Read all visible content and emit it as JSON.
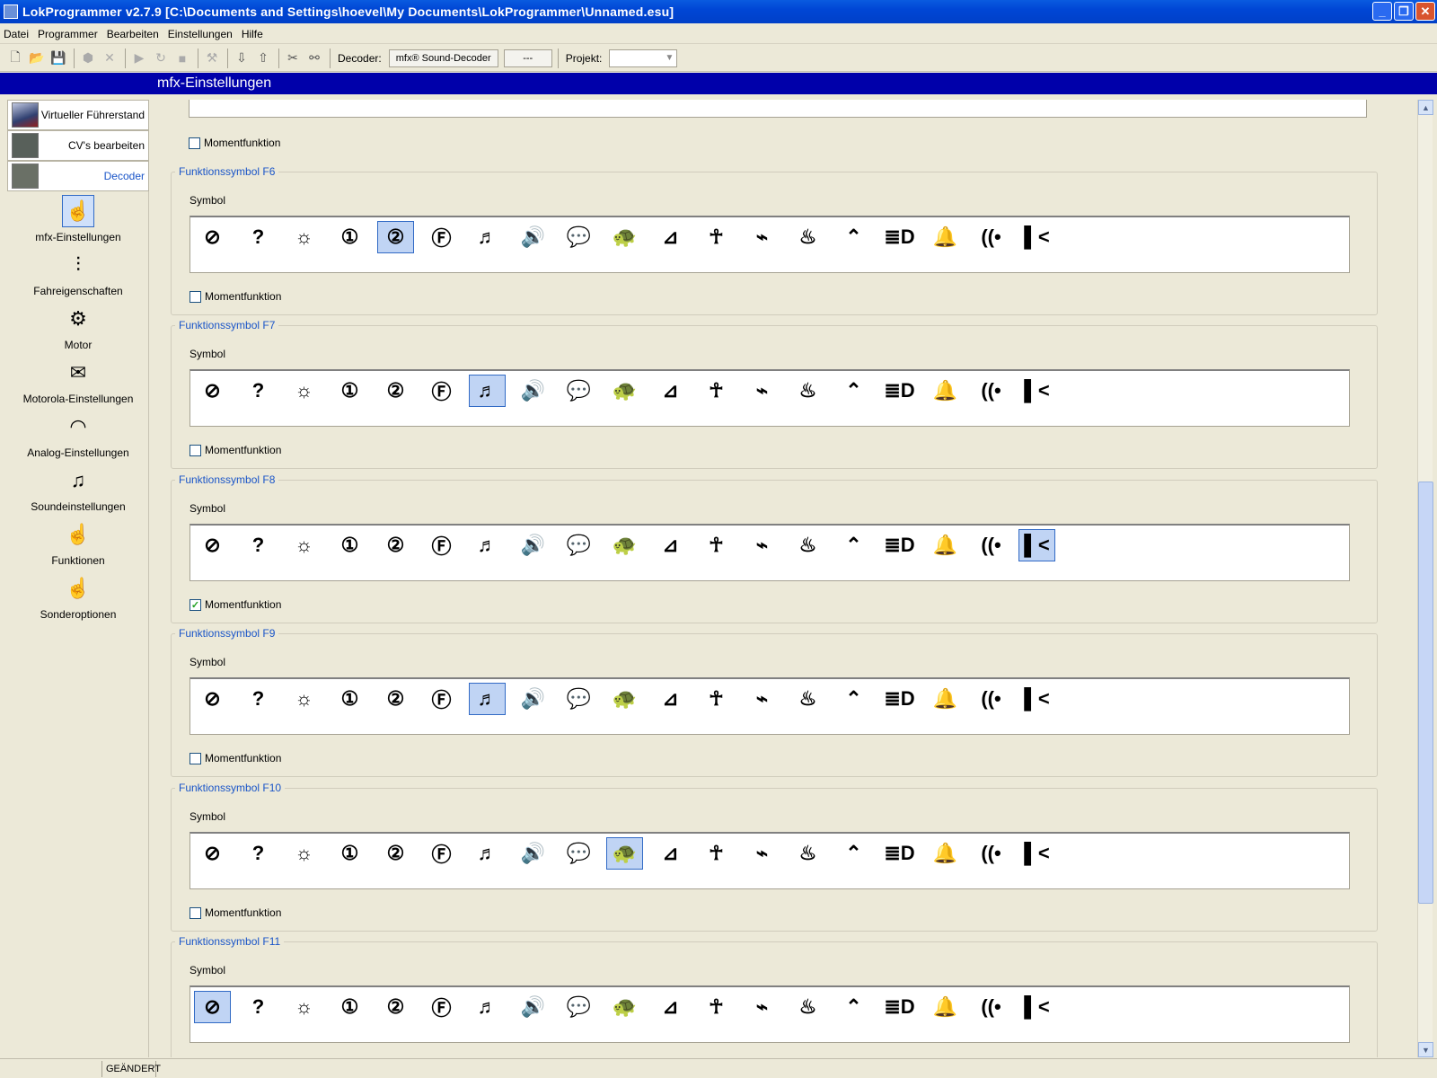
{
  "window": {
    "title": "LokProgrammer  v2.7.9  [C:\\Documents and Settings\\hoevel\\My Documents\\LokProgrammer\\Unnamed.esu]"
  },
  "menu": [
    "Datei",
    "Programmer",
    "Bearbeiten",
    "Einstellungen",
    "Hilfe"
  ],
  "toolbar": {
    "decoder_label": "Decoder:",
    "decoder_value": "mfx® Sound-Decoder",
    "decoder_extra": "---",
    "projekt_label": "Projekt:"
  },
  "header": {
    "title": "mfx-Einstellungen"
  },
  "sidebar": {
    "top": [
      {
        "label": "Virtueller Führerstand"
      },
      {
        "label": "CV's bearbeiten"
      },
      {
        "label": "Decoder"
      }
    ],
    "items": [
      {
        "label": "mfx-Einstellungen",
        "icon": "hand-switch-icon"
      },
      {
        "label": "Fahreigenschaften",
        "icon": "sliders-icon"
      },
      {
        "label": "Motor",
        "icon": "motor-icon"
      },
      {
        "label": "Motorola-Einstellungen",
        "icon": "envelope-icon"
      },
      {
        "label": "Analog-Einstellungen",
        "icon": "dcc-gauge-icon"
      },
      {
        "label": "Soundeinstellungen",
        "icon": "music-sliders-icon"
      },
      {
        "label": "Funktionen",
        "icon": "hand-switch-icon"
      },
      {
        "label": "Sonderoptionen",
        "icon": "hand-switch-icon"
      }
    ]
  },
  "main": {
    "symbol_label": "Symbol",
    "moment_label": "Momentfunktion",
    "symbols": [
      "none",
      "question",
      "light",
      "light-1",
      "light-2",
      "F",
      "sound-horn",
      "speaker",
      "speech",
      "turtle",
      "coupler",
      "person",
      "rail-break",
      "steam",
      "pantograph",
      "headlight",
      "bell",
      "whistle",
      "cab-light"
    ],
    "groups": [
      {
        "title": "Funktionssymbol F6",
        "selected": 4,
        "moment": false
      },
      {
        "title": "Funktionssymbol F7",
        "selected": 6,
        "moment": false
      },
      {
        "title": "Funktionssymbol F8",
        "selected": 18,
        "moment": true
      },
      {
        "title": "Funktionssymbol F9",
        "selected": 6,
        "moment": false
      },
      {
        "title": "Funktionssymbol F10",
        "selected": 9,
        "moment": false
      },
      {
        "title": "Funktionssymbol F11",
        "selected": 0,
        "moment": false
      }
    ]
  },
  "status": {
    "changed": "GEÄNDERT"
  }
}
